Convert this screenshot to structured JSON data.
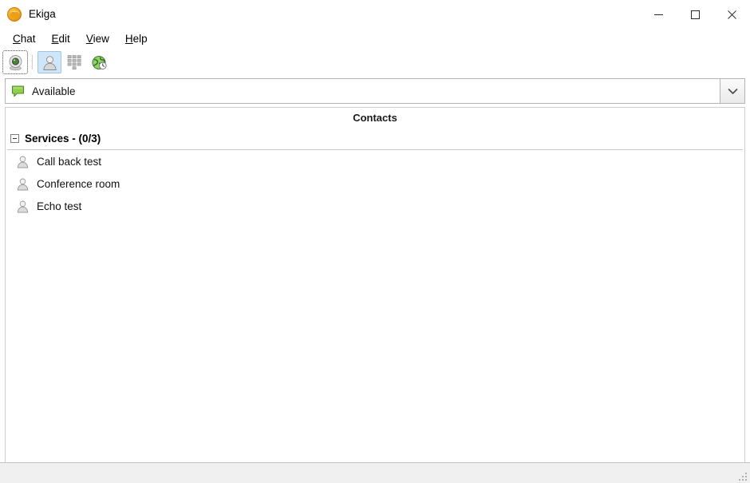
{
  "window": {
    "title": "Ekiga",
    "app_icon": "ekiga-logo-icon",
    "controls": [
      {
        "name": "minimize-button",
        "icon": "minimize-icon",
        "label": "Minimize"
      },
      {
        "name": "maximize-button",
        "icon": "maximize-icon",
        "label": "Maximize"
      },
      {
        "name": "close-button",
        "icon": "close-icon",
        "label": "Close"
      }
    ]
  },
  "menubar": {
    "items": [
      {
        "label": "Chat",
        "accel": "C",
        "rest": "hat"
      },
      {
        "label": "Edit",
        "accel": "E",
        "rest": "dit"
      },
      {
        "label": "View",
        "accel": "V",
        "rest": "iew"
      },
      {
        "label": "Help",
        "accel": "H",
        "rest": "elp"
      }
    ]
  },
  "toolbar": {
    "buttons": [
      {
        "name": "video-preview-button",
        "icon": "webcam-icon",
        "state": "focused",
        "tooltip": "Video Preview"
      },
      {
        "name": "contacts-button",
        "icon": "person-icon",
        "state": "active",
        "tooltip": "Contacts"
      },
      {
        "name": "dialpad-button",
        "icon": "dialpad-icon",
        "state": "normal",
        "tooltip": "Dialpad"
      },
      {
        "name": "call-history-button",
        "icon": "globe-icon",
        "state": "normal",
        "tooltip": "Call History"
      }
    ]
  },
  "presence": {
    "icon": "green-speech-bubble-icon",
    "status": "Available",
    "status_color": "#7fc241",
    "dropdown_icon": "chevron-down-icon"
  },
  "contacts": {
    "header": "Contacts",
    "groups": [
      {
        "name": "Services",
        "online": 0,
        "total": 3,
        "label": "Services - (0/3)",
        "expanded": true,
        "expander_icon": "collapse-minus-icon",
        "contacts": [
          {
            "name": "Call back test",
            "icon": "avatar-icon"
          },
          {
            "name": "Conference room",
            "icon": "avatar-icon"
          },
          {
            "name": "Echo test",
            "icon": "avatar-icon"
          }
        ]
      }
    ]
  },
  "statusbar": {
    "text": "",
    "grip_icon": "resize-grip-icon"
  },
  "colors": {
    "accent_active": "#cfe6fa",
    "presence_green": "#7fc241",
    "window_bg": "#ffffff",
    "statusbar_bg": "#f0f0f0",
    "border": "#cfcfcf"
  }
}
